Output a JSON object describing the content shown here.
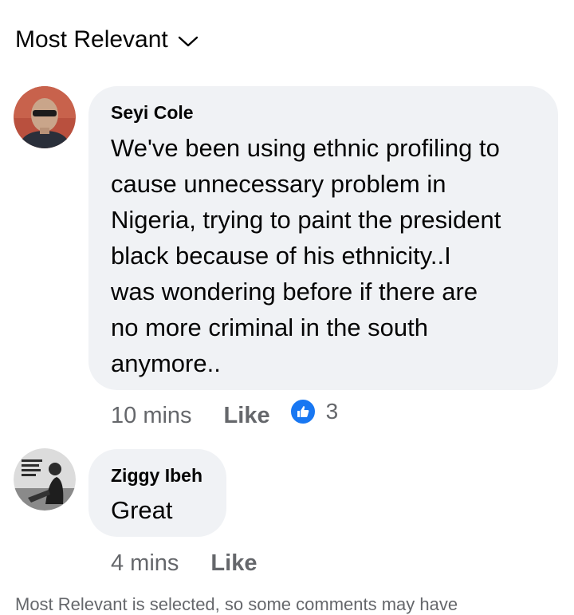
{
  "sort": {
    "label": "Most Relevant",
    "icon": "chevron-down-icon"
  },
  "comments": [
    {
      "author": "Seyi Cole",
      "text": "We've been using ethnic profiling to\ncause unnecessary problem in\nNigeria, trying to paint the president\nblack because of his ethnicity..I\nwas wondering before if there are\nno more criminal in the south\nanymore..",
      "time": "10 mins",
      "like_label": "Like",
      "reaction_icon": "thumbs-up-icon",
      "reaction_count": "3"
    },
    {
      "author": "Ziggy Ibeh",
      "text": "Great",
      "time": "4 mins",
      "like_label": "Like"
    }
  ],
  "footer_note": "Most Relevant is selected, so some comments may have",
  "colors": {
    "bubble": "#f0f2f5",
    "text": "#050505",
    "secondary": "#65676b",
    "like_blue": "#1877f2"
  }
}
